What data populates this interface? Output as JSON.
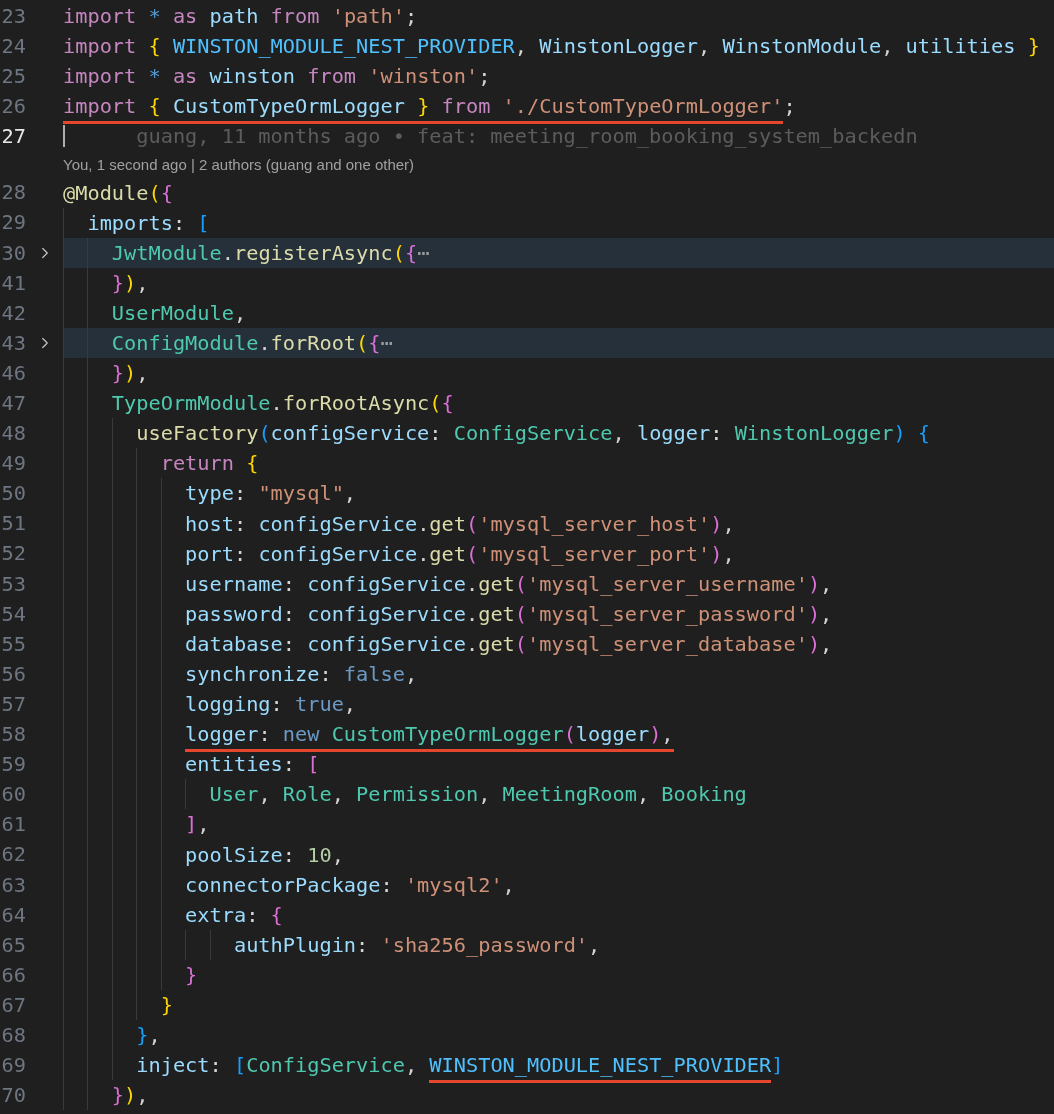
{
  "editor": {
    "lines": [
      {
        "kind": "code",
        "number": "23",
        "current": false,
        "folded": false,
        "tokens": [
          {
            "text": "import ",
            "kind": "keyword"
          },
          {
            "text": "* ",
            "kind": "operator"
          },
          {
            "text": "as ",
            "kind": "keyword"
          },
          {
            "text": "path ",
            "kind": "variable"
          },
          {
            "text": "from ",
            "kind": "keyword"
          },
          {
            "text": "'path'",
            "kind": "string"
          },
          {
            "text": ";",
            "kind": "plain"
          }
        ]
      },
      {
        "kind": "code",
        "number": "24",
        "current": false,
        "folded": false,
        "tokens": [
          {
            "text": "import ",
            "kind": "keyword"
          },
          {
            "text": "{ ",
            "kind": "bracket1"
          },
          {
            "text": "WINSTON_MODULE_NEST_PROVIDER",
            "kind": "constant"
          },
          {
            "text": ", ",
            "kind": "plain"
          },
          {
            "text": "WinstonLogger",
            "kind": "variable"
          },
          {
            "text": ", ",
            "kind": "plain"
          },
          {
            "text": "WinstonModule",
            "kind": "variable"
          },
          {
            "text": ", ",
            "kind": "plain"
          },
          {
            "text": "utilities ",
            "kind": "variable"
          },
          {
            "text": "}",
            "kind": "bracket1"
          }
        ]
      },
      {
        "kind": "code",
        "number": "25",
        "current": false,
        "folded": false,
        "tokens": [
          {
            "text": "import ",
            "kind": "keyword"
          },
          {
            "text": "* ",
            "kind": "operator"
          },
          {
            "text": "as ",
            "kind": "keyword"
          },
          {
            "text": "winston ",
            "kind": "variable"
          },
          {
            "text": "from ",
            "kind": "keyword"
          },
          {
            "text": "'winston'",
            "kind": "string"
          },
          {
            "text": ";",
            "kind": "plain"
          }
        ]
      },
      {
        "kind": "code",
        "number": "26",
        "current": false,
        "folded": false,
        "tokens": [
          {
            "text": "import ",
            "kind": "keyword",
            "marked": true
          },
          {
            "text": "{ ",
            "kind": "bracket1",
            "marked": true
          },
          {
            "text": "CustomTypeOrmLogger ",
            "kind": "variable",
            "marked": true
          },
          {
            "text": "} ",
            "kind": "bracket1",
            "marked": true
          },
          {
            "text": "from ",
            "kind": "keyword",
            "marked": true
          },
          {
            "text": "'./CustomTypeOrmLogger'",
            "kind": "string",
            "marked": true
          },
          {
            "text": ";",
            "kind": "plain"
          }
        ]
      },
      {
        "kind": "code",
        "number": "27",
        "current": true,
        "folded": false,
        "blame": "guang, 11 months ago • feat: meeting_room_booking_system_backedn"
      },
      {
        "kind": "codelens",
        "text": "You, 1 second ago | 2 authors (guang and one other)"
      },
      {
        "kind": "code",
        "number": "28",
        "current": false,
        "folded": false,
        "tokens": [
          {
            "text": "@Module",
            "kind": "function"
          },
          {
            "text": "(",
            "kind": "bracket1"
          },
          {
            "text": "{",
            "kind": "bracket2"
          }
        ]
      },
      {
        "kind": "code",
        "number": "29",
        "current": false,
        "folded": false,
        "tokens": [
          {
            "text": "  imports",
            "kind": "variable"
          },
          {
            "text": ": ",
            "kind": "plain"
          },
          {
            "text": "[",
            "kind": "bracket3"
          }
        ]
      },
      {
        "kind": "code",
        "number": "30",
        "current": false,
        "folded": true,
        "tokens": [
          {
            "text": "    JwtModule",
            "kind": "type"
          },
          {
            "text": ".",
            "kind": "plain"
          },
          {
            "text": "registerAsync",
            "kind": "function"
          },
          {
            "text": "(",
            "kind": "bracket1"
          },
          {
            "text": "{",
            "kind": "bracket2"
          },
          {
            "text": "⋯",
            "kind": "ellipsis"
          }
        ]
      },
      {
        "kind": "code",
        "number": "41",
        "current": false,
        "folded": false,
        "tokens": [
          {
            "text": "    }",
            "kind": "bracket2"
          },
          {
            "text": ")",
            "kind": "bracket1"
          },
          {
            "text": ",",
            "kind": "plain"
          }
        ]
      },
      {
        "kind": "code",
        "number": "42",
        "current": false,
        "folded": false,
        "tokens": [
          {
            "text": "    UserModule",
            "kind": "type"
          },
          {
            "text": ",",
            "kind": "plain"
          }
        ]
      },
      {
        "kind": "code",
        "number": "43",
        "current": false,
        "folded": true,
        "tokens": [
          {
            "text": "    ConfigModule",
            "kind": "type"
          },
          {
            "text": ".",
            "kind": "plain"
          },
          {
            "text": "forRoot",
            "kind": "function"
          },
          {
            "text": "(",
            "kind": "bracket1"
          },
          {
            "text": "{",
            "kind": "bracket2"
          },
          {
            "text": "⋯",
            "kind": "ellipsis"
          }
        ]
      },
      {
        "kind": "code",
        "number": "46",
        "current": false,
        "folded": false,
        "tokens": [
          {
            "text": "    }",
            "kind": "bracket2"
          },
          {
            "text": ")",
            "kind": "bracket1"
          },
          {
            "text": ",",
            "kind": "plain"
          }
        ]
      },
      {
        "kind": "code",
        "number": "47",
        "current": false,
        "folded": false,
        "tokens": [
          {
            "text": "    TypeOrmModule",
            "kind": "type"
          },
          {
            "text": ".",
            "kind": "plain"
          },
          {
            "text": "forRootAsync",
            "kind": "function"
          },
          {
            "text": "(",
            "kind": "bracket1"
          },
          {
            "text": "{",
            "kind": "bracket2"
          }
        ]
      },
      {
        "kind": "code",
        "number": "48",
        "current": false,
        "folded": false,
        "tokens": [
          {
            "text": "      useFactory",
            "kind": "function"
          },
          {
            "text": "(",
            "kind": "bracket3"
          },
          {
            "text": "configService",
            "kind": "variable"
          },
          {
            "text": ": ",
            "kind": "plain"
          },
          {
            "text": "ConfigService",
            "kind": "type"
          },
          {
            "text": ", ",
            "kind": "plain"
          },
          {
            "text": "logger",
            "kind": "variable"
          },
          {
            "text": ": ",
            "kind": "plain"
          },
          {
            "text": "WinstonLogger",
            "kind": "type"
          },
          {
            "text": ")",
            "kind": "bracket3"
          },
          {
            "text": " {",
            "kind": "bracket3"
          }
        ]
      },
      {
        "kind": "code",
        "number": "49",
        "current": false,
        "folded": false,
        "tokens": [
          {
            "text": "        return ",
            "kind": "keyword"
          },
          {
            "text": "{",
            "kind": "bracket1"
          }
        ]
      },
      {
        "kind": "code",
        "number": "50",
        "current": false,
        "folded": false,
        "tokens": [
          {
            "text": "          type",
            "kind": "variable"
          },
          {
            "text": ": ",
            "kind": "plain"
          },
          {
            "text": "\"mysql\"",
            "kind": "string"
          },
          {
            "text": ",",
            "kind": "plain"
          }
        ]
      },
      {
        "kind": "code",
        "number": "51",
        "current": false,
        "folded": false,
        "tokens": [
          {
            "text": "          host",
            "kind": "variable"
          },
          {
            "text": ": ",
            "kind": "plain"
          },
          {
            "text": "configService",
            "kind": "variable"
          },
          {
            "text": ".",
            "kind": "plain"
          },
          {
            "text": "get",
            "kind": "function"
          },
          {
            "text": "(",
            "kind": "bracket2"
          },
          {
            "text": "'mysql_server_host'",
            "kind": "string"
          },
          {
            "text": ")",
            "kind": "bracket2"
          },
          {
            "text": ",",
            "kind": "plain"
          }
        ]
      },
      {
        "kind": "code",
        "number": "52",
        "current": false,
        "folded": false,
        "tokens": [
          {
            "text": "          port",
            "kind": "variable"
          },
          {
            "text": ": ",
            "kind": "plain"
          },
          {
            "text": "configService",
            "kind": "variable"
          },
          {
            "text": ".",
            "kind": "plain"
          },
          {
            "text": "get",
            "kind": "function"
          },
          {
            "text": "(",
            "kind": "bracket2"
          },
          {
            "text": "'mysql_server_port'",
            "kind": "string"
          },
          {
            "text": ")",
            "kind": "bracket2"
          },
          {
            "text": ",",
            "kind": "plain"
          }
        ]
      },
      {
        "kind": "code",
        "number": "53",
        "current": false,
        "folded": false,
        "tokens": [
          {
            "text": "          username",
            "kind": "variable"
          },
          {
            "text": ": ",
            "kind": "plain"
          },
          {
            "text": "configService",
            "kind": "variable"
          },
          {
            "text": ".",
            "kind": "plain"
          },
          {
            "text": "get",
            "kind": "function"
          },
          {
            "text": "(",
            "kind": "bracket2"
          },
          {
            "text": "'mysql_server_username'",
            "kind": "string"
          },
          {
            "text": ")",
            "kind": "bracket2"
          },
          {
            "text": ",",
            "kind": "plain"
          }
        ]
      },
      {
        "kind": "code",
        "number": "54",
        "current": false,
        "folded": false,
        "tokens": [
          {
            "text": "          password",
            "kind": "variable"
          },
          {
            "text": ": ",
            "kind": "plain"
          },
          {
            "text": "configService",
            "kind": "variable"
          },
          {
            "text": ".",
            "kind": "plain"
          },
          {
            "text": "get",
            "kind": "function"
          },
          {
            "text": "(",
            "kind": "bracket2"
          },
          {
            "text": "'mysql_server_password'",
            "kind": "string"
          },
          {
            "text": ")",
            "kind": "bracket2"
          },
          {
            "text": ",",
            "kind": "plain"
          }
        ]
      },
      {
        "kind": "code",
        "number": "55",
        "current": false,
        "folded": false,
        "tokens": [
          {
            "text": "          database",
            "kind": "variable"
          },
          {
            "text": ": ",
            "kind": "plain"
          },
          {
            "text": "configService",
            "kind": "variable"
          },
          {
            "text": ".",
            "kind": "plain"
          },
          {
            "text": "get",
            "kind": "function"
          },
          {
            "text": "(",
            "kind": "bracket2"
          },
          {
            "text": "'mysql_server_database'",
            "kind": "string"
          },
          {
            "text": ")",
            "kind": "bracket2"
          },
          {
            "text": ",",
            "kind": "plain"
          }
        ]
      },
      {
        "kind": "code",
        "number": "56",
        "current": false,
        "folded": false,
        "tokens": [
          {
            "text": "          synchronize",
            "kind": "variable"
          },
          {
            "text": ": ",
            "kind": "plain"
          },
          {
            "text": "false",
            "kind": "literal"
          },
          {
            "text": ",",
            "kind": "plain"
          }
        ]
      },
      {
        "kind": "code",
        "number": "57",
        "current": false,
        "folded": false,
        "tokens": [
          {
            "text": "          logging",
            "kind": "variable"
          },
          {
            "text": ": ",
            "kind": "plain"
          },
          {
            "text": "true",
            "kind": "literal"
          },
          {
            "text": ",",
            "kind": "plain"
          }
        ]
      },
      {
        "kind": "code",
        "number": "58",
        "current": false,
        "folded": false,
        "tokens": [
          {
            "text": "          logger",
            "kind": "variable",
            "marked": true
          },
          {
            "text": ": ",
            "kind": "plain",
            "marked": true
          },
          {
            "text": "new ",
            "kind": "literal",
            "marked": true
          },
          {
            "text": "CustomTypeOrmLogger",
            "kind": "type",
            "marked": true
          },
          {
            "text": "(",
            "kind": "bracket2",
            "marked": true
          },
          {
            "text": "logger",
            "kind": "variable",
            "marked": true
          },
          {
            "text": ")",
            "kind": "bracket2",
            "marked": true
          },
          {
            "text": ",",
            "kind": "plain",
            "marked": true
          }
        ]
      },
      {
        "kind": "code",
        "number": "59",
        "current": false,
        "folded": false,
        "tokens": [
          {
            "text": "          entities",
            "kind": "variable"
          },
          {
            "text": ": ",
            "kind": "plain"
          },
          {
            "text": "[",
            "kind": "bracket2"
          }
        ]
      },
      {
        "kind": "code",
        "number": "60",
        "current": false,
        "folded": false,
        "tokens": [
          {
            "text": "            User",
            "kind": "type"
          },
          {
            "text": ", ",
            "kind": "plain"
          },
          {
            "text": "Role",
            "kind": "type"
          },
          {
            "text": ", ",
            "kind": "plain"
          },
          {
            "text": "Permission",
            "kind": "type"
          },
          {
            "text": ", ",
            "kind": "plain"
          },
          {
            "text": "MeetingRoom",
            "kind": "type"
          },
          {
            "text": ", ",
            "kind": "plain"
          },
          {
            "text": "Booking",
            "kind": "type"
          }
        ]
      },
      {
        "kind": "code",
        "number": "61",
        "current": false,
        "folded": false,
        "tokens": [
          {
            "text": "          ]",
            "kind": "bracket2"
          },
          {
            "text": ",",
            "kind": "plain"
          }
        ]
      },
      {
        "kind": "code",
        "number": "62",
        "current": false,
        "folded": false,
        "tokens": [
          {
            "text": "          poolSize",
            "kind": "variable"
          },
          {
            "text": ": ",
            "kind": "plain"
          },
          {
            "text": "10",
            "kind": "number"
          },
          {
            "text": ",",
            "kind": "plain"
          }
        ]
      },
      {
        "kind": "code",
        "number": "63",
        "current": false,
        "folded": false,
        "tokens": [
          {
            "text": "          connectorPackage",
            "kind": "variable"
          },
          {
            "text": ": ",
            "kind": "plain"
          },
          {
            "text": "'mysql2'",
            "kind": "string"
          },
          {
            "text": ",",
            "kind": "plain"
          }
        ]
      },
      {
        "kind": "code",
        "number": "64",
        "current": false,
        "folded": false,
        "tokens": [
          {
            "text": "          extra",
            "kind": "variable"
          },
          {
            "text": ": ",
            "kind": "plain"
          },
          {
            "text": "{",
            "kind": "bracket2"
          }
        ]
      },
      {
        "kind": "code",
        "number": "65",
        "current": false,
        "folded": false,
        "tokens": [
          {
            "text": "              authPlugin",
            "kind": "variable"
          },
          {
            "text": ": ",
            "kind": "plain"
          },
          {
            "text": "'sha256_password'",
            "kind": "string"
          },
          {
            "text": ",",
            "kind": "plain"
          }
        ]
      },
      {
        "kind": "code",
        "number": "66",
        "current": false,
        "folded": false,
        "tokens": [
          {
            "text": "          }",
            "kind": "bracket2"
          }
        ]
      },
      {
        "kind": "code",
        "number": "67",
        "current": false,
        "folded": false,
        "tokens": [
          {
            "text": "        }",
            "kind": "bracket1"
          }
        ]
      },
      {
        "kind": "code",
        "number": "68",
        "current": false,
        "folded": false,
        "tokens": [
          {
            "text": "      }",
            "kind": "bracket3"
          },
          {
            "text": ",",
            "kind": "plain"
          }
        ]
      },
      {
        "kind": "code",
        "number": "69",
        "current": false,
        "folded": false,
        "tokens": [
          {
            "text": "      inject",
            "kind": "variable"
          },
          {
            "text": ": ",
            "kind": "plain"
          },
          {
            "text": "[",
            "kind": "bracket3"
          },
          {
            "text": "ConfigService",
            "kind": "type"
          },
          {
            "text": ", ",
            "kind": "plain"
          },
          {
            "text": "WINSTON_MODULE_NEST_PROVIDER",
            "kind": "constant",
            "marked": true
          },
          {
            "text": "]",
            "kind": "bracket3"
          }
        ]
      },
      {
        "kind": "code",
        "number": "70",
        "current": false,
        "folded": false,
        "tokens": [
          {
            "text": "    }",
            "kind": "bracket2"
          },
          {
            "text": ")",
            "kind": "bracket1"
          },
          {
            "text": ",",
            "kind": "plain"
          }
        ]
      }
    ]
  }
}
